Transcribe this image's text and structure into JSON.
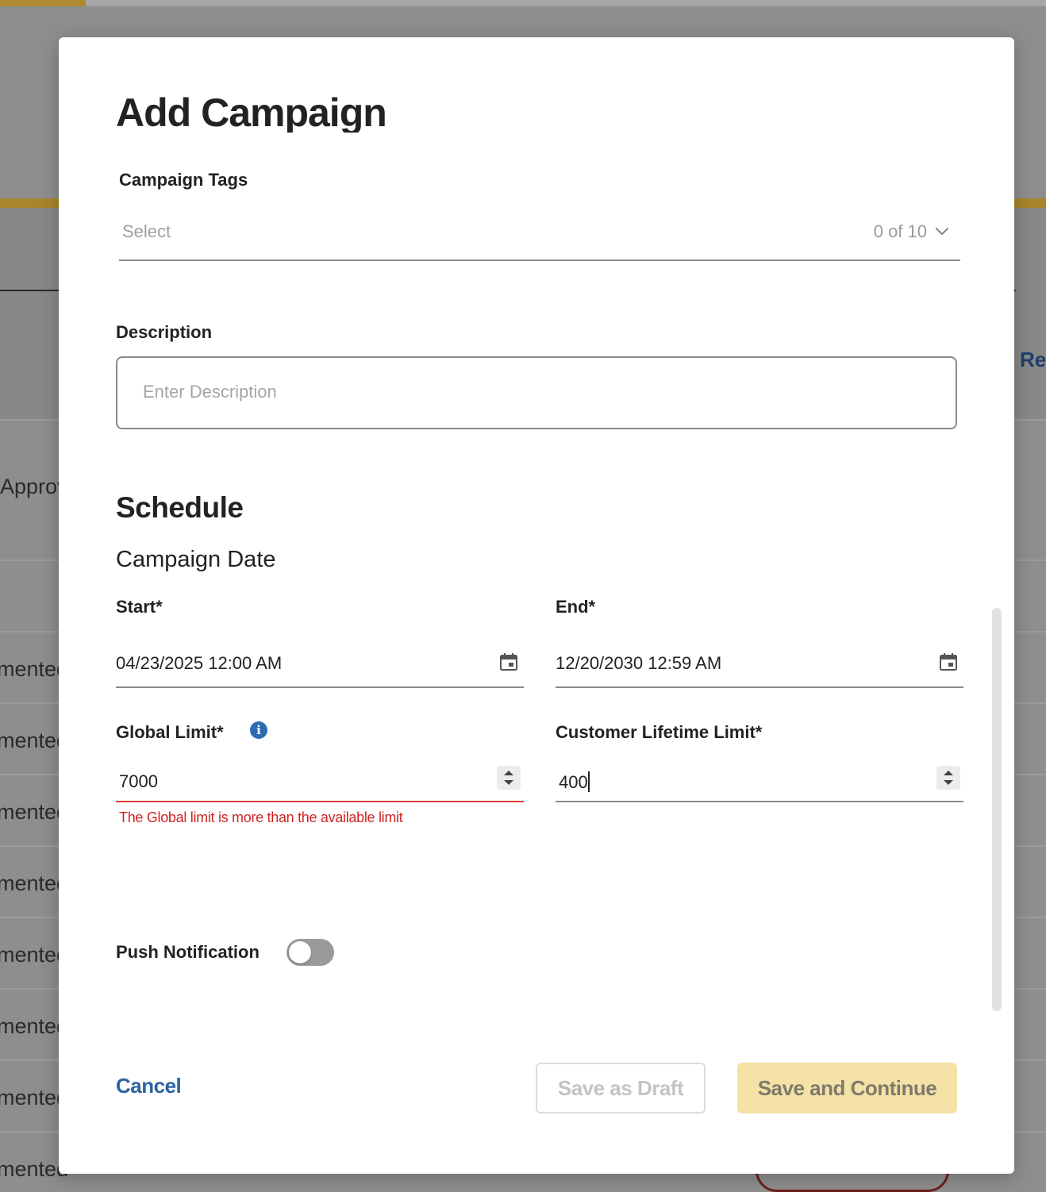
{
  "background": {
    "right_link_fragment": "Re",
    "row_labels": [
      "Approv",
      "mented",
      "mented",
      "mented",
      "mented",
      "mented",
      "mented",
      "mented",
      "mented"
    ]
  },
  "modal": {
    "title": "Add Campaign",
    "campaign_tags": {
      "label": "Campaign Tags",
      "placeholder": "Select",
      "count": "0 of 10"
    },
    "description": {
      "label": "Description",
      "placeholder": "Enter Description",
      "value": ""
    },
    "schedule": {
      "title": "Schedule",
      "subtitle": "Campaign Date",
      "start": {
        "label": "Start*",
        "value": "04/23/2025  12:00 AM"
      },
      "end": {
        "label": "End*",
        "value": "12/20/2030  12:59 AM"
      }
    },
    "limits": {
      "global": {
        "label": "Global Limit*",
        "value": "7000",
        "error": "The Global limit is more than the available limit"
      },
      "customer_lifetime": {
        "label": "Customer Lifetime Limit*",
        "value": "400"
      }
    },
    "push_notification": {
      "label": "Push Notification",
      "enabled": false
    },
    "footer": {
      "cancel_label": "Cancel",
      "draft_label": "Save as Draft",
      "continue_label": "Save and Continue"
    }
  },
  "colors": {
    "accent_blue": "#2b64a3",
    "error_red": "#d02424",
    "primary_button_bg": "#f4e2a6",
    "overlay_gray": "#8e8e8e"
  }
}
